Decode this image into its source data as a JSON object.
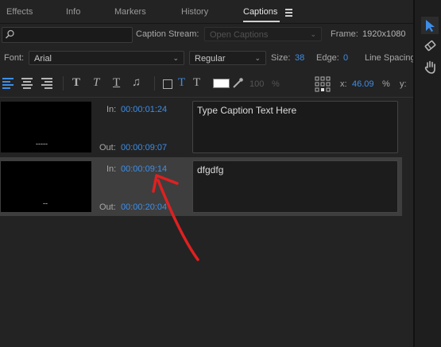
{
  "tabs": [
    {
      "label": "Effects"
    },
    {
      "label": "Info"
    },
    {
      "label": "Markers"
    },
    {
      "label": "History"
    },
    {
      "label": "Captions"
    }
  ],
  "search": {
    "icon": "search-icon",
    "value": "",
    "placeholder": ""
  },
  "caption_stream": {
    "label": "Caption Stream:",
    "value": "Open Captions"
  },
  "frame": {
    "label": "Frame:",
    "value": "1920x1080"
  },
  "font": {
    "label": "Font:",
    "value": "Arial"
  },
  "style": {
    "value": "Regular"
  },
  "size": {
    "label": "Size:",
    "value": "38"
  },
  "edge": {
    "label": "Edge:",
    "value": "0"
  },
  "line_spacing": {
    "label": "Line Spacing"
  },
  "opacity": {
    "value": "100",
    "unit": "%"
  },
  "position": {
    "x_label": "x:",
    "x_value": "46.09",
    "x_unit": "%",
    "y_label": "y:"
  },
  "captions": [
    {
      "in_label": "In:",
      "in": "00:00:01:24",
      "out_label": "Out:",
      "out": "00:00:09:07",
      "text": "Type Caption Text Here",
      "thumb_text": "-----"
    },
    {
      "in_label": "In:",
      "in": "00:00:09:14",
      "out_label": "Out:",
      "out": "00:00:20:04",
      "text": "dfgdfg",
      "thumb_text": "--"
    }
  ],
  "colors": {
    "accent": "#3d8ee8",
    "annotation": "#e02020",
    "background": "#232323",
    "selected_row": "#3e3e3e"
  }
}
